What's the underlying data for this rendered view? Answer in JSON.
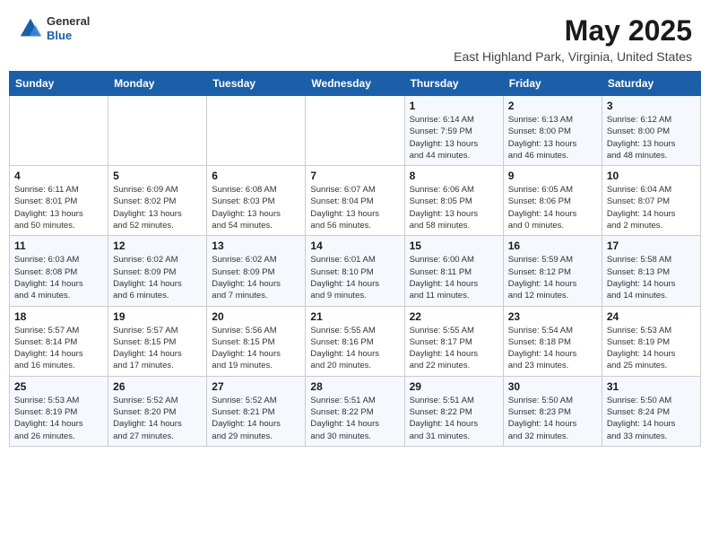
{
  "header": {
    "logo_general": "General",
    "logo_blue": "Blue",
    "month_title": "May 2025",
    "location": "East Highland Park, Virginia, United States"
  },
  "days_of_week": [
    "Sunday",
    "Monday",
    "Tuesday",
    "Wednesday",
    "Thursday",
    "Friday",
    "Saturday"
  ],
  "weeks": [
    [
      {
        "day": "",
        "info": ""
      },
      {
        "day": "",
        "info": ""
      },
      {
        "day": "",
        "info": ""
      },
      {
        "day": "",
        "info": ""
      },
      {
        "day": "1",
        "info": "Sunrise: 6:14 AM\nSunset: 7:59 PM\nDaylight: 13 hours\nand 44 minutes."
      },
      {
        "day": "2",
        "info": "Sunrise: 6:13 AM\nSunset: 8:00 PM\nDaylight: 13 hours\nand 46 minutes."
      },
      {
        "day": "3",
        "info": "Sunrise: 6:12 AM\nSunset: 8:00 PM\nDaylight: 13 hours\nand 48 minutes."
      }
    ],
    [
      {
        "day": "4",
        "info": "Sunrise: 6:11 AM\nSunset: 8:01 PM\nDaylight: 13 hours\nand 50 minutes."
      },
      {
        "day": "5",
        "info": "Sunrise: 6:09 AM\nSunset: 8:02 PM\nDaylight: 13 hours\nand 52 minutes."
      },
      {
        "day": "6",
        "info": "Sunrise: 6:08 AM\nSunset: 8:03 PM\nDaylight: 13 hours\nand 54 minutes."
      },
      {
        "day": "7",
        "info": "Sunrise: 6:07 AM\nSunset: 8:04 PM\nDaylight: 13 hours\nand 56 minutes."
      },
      {
        "day": "8",
        "info": "Sunrise: 6:06 AM\nSunset: 8:05 PM\nDaylight: 13 hours\nand 58 minutes."
      },
      {
        "day": "9",
        "info": "Sunrise: 6:05 AM\nSunset: 8:06 PM\nDaylight: 14 hours\nand 0 minutes."
      },
      {
        "day": "10",
        "info": "Sunrise: 6:04 AM\nSunset: 8:07 PM\nDaylight: 14 hours\nand 2 minutes."
      }
    ],
    [
      {
        "day": "11",
        "info": "Sunrise: 6:03 AM\nSunset: 8:08 PM\nDaylight: 14 hours\nand 4 minutes."
      },
      {
        "day": "12",
        "info": "Sunrise: 6:02 AM\nSunset: 8:09 PM\nDaylight: 14 hours\nand 6 minutes."
      },
      {
        "day": "13",
        "info": "Sunrise: 6:02 AM\nSunset: 8:09 PM\nDaylight: 14 hours\nand 7 minutes."
      },
      {
        "day": "14",
        "info": "Sunrise: 6:01 AM\nSunset: 8:10 PM\nDaylight: 14 hours\nand 9 minutes."
      },
      {
        "day": "15",
        "info": "Sunrise: 6:00 AM\nSunset: 8:11 PM\nDaylight: 14 hours\nand 11 minutes."
      },
      {
        "day": "16",
        "info": "Sunrise: 5:59 AM\nSunset: 8:12 PM\nDaylight: 14 hours\nand 12 minutes."
      },
      {
        "day": "17",
        "info": "Sunrise: 5:58 AM\nSunset: 8:13 PM\nDaylight: 14 hours\nand 14 minutes."
      }
    ],
    [
      {
        "day": "18",
        "info": "Sunrise: 5:57 AM\nSunset: 8:14 PM\nDaylight: 14 hours\nand 16 minutes."
      },
      {
        "day": "19",
        "info": "Sunrise: 5:57 AM\nSunset: 8:15 PM\nDaylight: 14 hours\nand 17 minutes."
      },
      {
        "day": "20",
        "info": "Sunrise: 5:56 AM\nSunset: 8:15 PM\nDaylight: 14 hours\nand 19 minutes."
      },
      {
        "day": "21",
        "info": "Sunrise: 5:55 AM\nSunset: 8:16 PM\nDaylight: 14 hours\nand 20 minutes."
      },
      {
        "day": "22",
        "info": "Sunrise: 5:55 AM\nSunset: 8:17 PM\nDaylight: 14 hours\nand 22 minutes."
      },
      {
        "day": "23",
        "info": "Sunrise: 5:54 AM\nSunset: 8:18 PM\nDaylight: 14 hours\nand 23 minutes."
      },
      {
        "day": "24",
        "info": "Sunrise: 5:53 AM\nSunset: 8:19 PM\nDaylight: 14 hours\nand 25 minutes."
      }
    ],
    [
      {
        "day": "25",
        "info": "Sunrise: 5:53 AM\nSunset: 8:19 PM\nDaylight: 14 hours\nand 26 minutes."
      },
      {
        "day": "26",
        "info": "Sunrise: 5:52 AM\nSunset: 8:20 PM\nDaylight: 14 hours\nand 27 minutes."
      },
      {
        "day": "27",
        "info": "Sunrise: 5:52 AM\nSunset: 8:21 PM\nDaylight: 14 hours\nand 29 minutes."
      },
      {
        "day": "28",
        "info": "Sunrise: 5:51 AM\nSunset: 8:22 PM\nDaylight: 14 hours\nand 30 minutes."
      },
      {
        "day": "29",
        "info": "Sunrise: 5:51 AM\nSunset: 8:22 PM\nDaylight: 14 hours\nand 31 minutes."
      },
      {
        "day": "30",
        "info": "Sunrise: 5:50 AM\nSunset: 8:23 PM\nDaylight: 14 hours\nand 32 minutes."
      },
      {
        "day": "31",
        "info": "Sunrise: 5:50 AM\nSunset: 8:24 PM\nDaylight: 14 hours\nand 33 minutes."
      }
    ]
  ]
}
